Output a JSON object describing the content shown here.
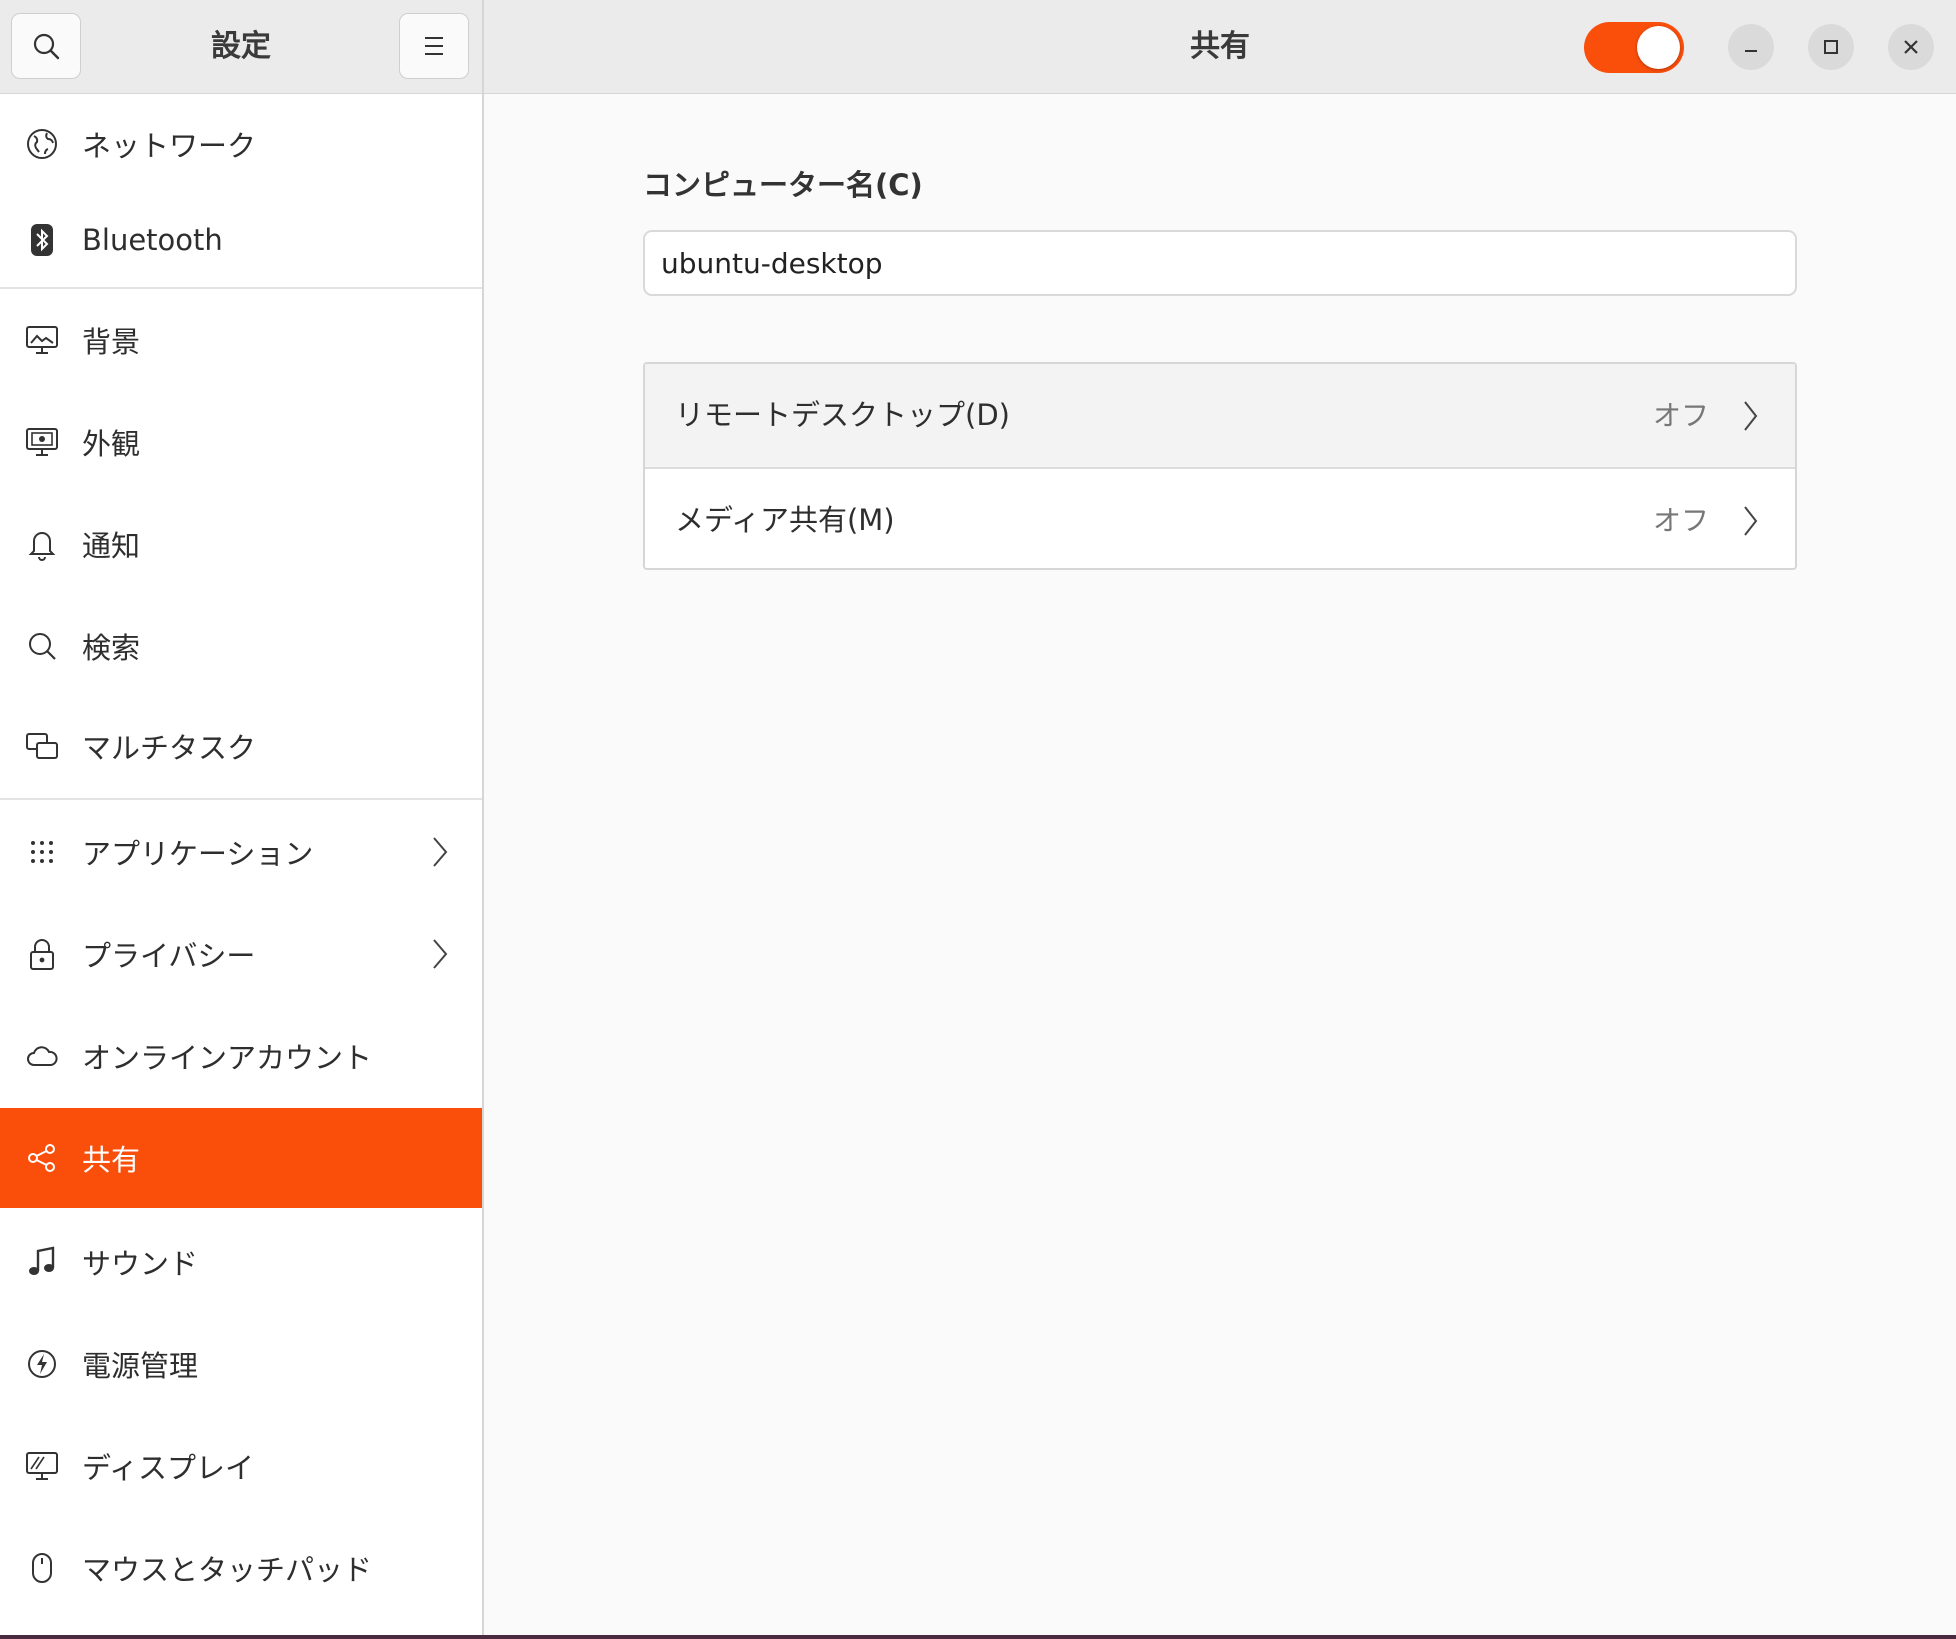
{
  "header": {
    "sidebar_title": "設定",
    "page_title": "共有",
    "sharing_switch_on": true,
    "colors": {
      "accent": "#fa4e0b",
      "header_bg": "#ebebeb"
    }
  },
  "sidebar": {
    "items": [
      {
        "label": "ネットワーク",
        "icon": "network-globe-icon"
      },
      {
        "label": "Bluetooth",
        "icon": "bluetooth-icon"
      },
      {
        "label": "背景",
        "icon": "background-monitor-icon"
      },
      {
        "label": "外観",
        "icon": "appearance-monitor-icon"
      },
      {
        "label": "通知",
        "icon": "bell-icon"
      },
      {
        "label": "検索",
        "icon": "search-icon"
      },
      {
        "label": "マルチタスク",
        "icon": "multitask-windows-icon"
      },
      {
        "label": "アプリケーション",
        "icon": "apps-grid-icon",
        "has_chevron": true
      },
      {
        "label": "プライバシー",
        "icon": "lock-icon",
        "has_chevron": true
      },
      {
        "label": "オンラインアカウント",
        "icon": "cloud-icon"
      },
      {
        "label": "共有",
        "icon": "share-icon",
        "active": true
      },
      {
        "label": "サウンド",
        "icon": "music-note-icon"
      },
      {
        "label": "電源管理",
        "icon": "power-icon"
      },
      {
        "label": "ディスプレイ",
        "icon": "display-icon"
      },
      {
        "label": "マウスとタッチパッド",
        "icon": "mouse-icon"
      }
    ]
  },
  "main": {
    "computer_name_label": "コンピューター名(C)",
    "computer_name_value": "ubuntu-desktop",
    "options": [
      {
        "label": "リモートデスクトップ(D)",
        "value": "オフ"
      },
      {
        "label": "メディア共有(M)",
        "value": "オフ"
      }
    ]
  }
}
